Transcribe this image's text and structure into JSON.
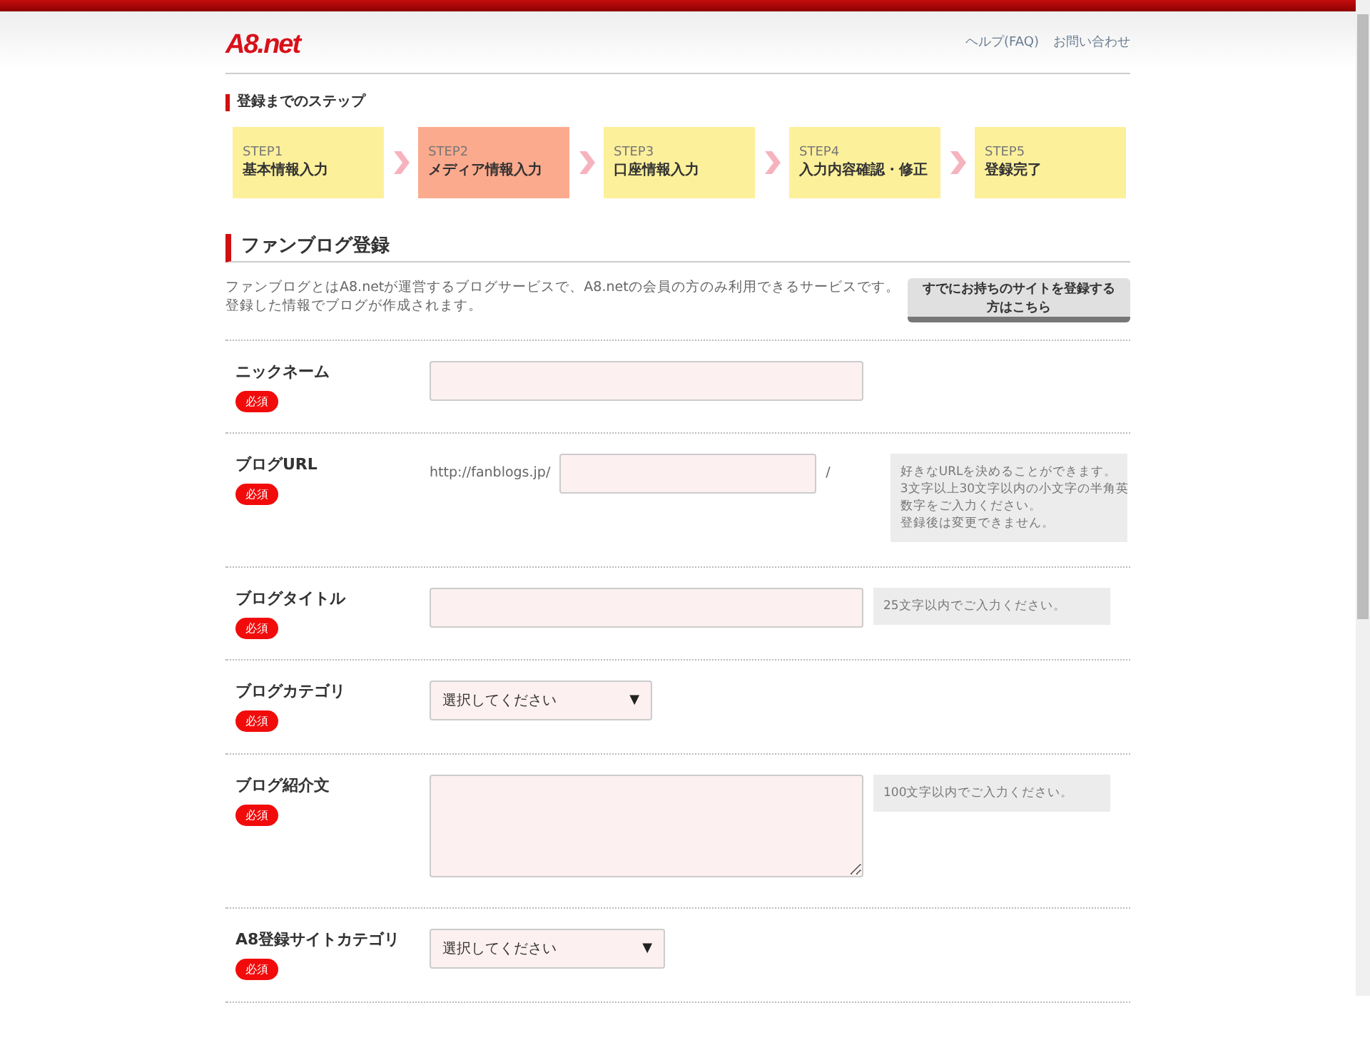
{
  "header": {
    "logo": "A8.net",
    "links": [
      "ヘルプ(FAQ)",
      "お問い合わせ"
    ]
  },
  "steps_section": {
    "title": "登録までのステップ",
    "steps": [
      {
        "number": "STEP1",
        "label": "基本情報入力",
        "selected": false
      },
      {
        "number": "STEP2",
        "label": "メディア情報入力",
        "selected": true
      },
      {
        "number": "STEP3",
        "label": "口座情報入力",
        "selected": false
      },
      {
        "number": "STEP4",
        "label": "入力内容確認・修正",
        "selected": false
      },
      {
        "number": "STEP5",
        "label": "登録完了",
        "selected": false
      }
    ]
  },
  "form": {
    "title": "ファンブログ登録",
    "description": [
      "ファンブログとはA8.netが運営するブログサービスで、A8.netの会員の方のみ利用できるサービスです。",
      "登録した情報でブログが作成されます。"
    ],
    "existing_site_button": "すでにお持ちのサイトを登録する方はこちら",
    "fields": [
      {
        "label": "ニックネーム",
        "badge": "必須",
        "kind": "text"
      },
      {
        "label": "ブログURL",
        "badge": "必須",
        "kind": "url",
        "prefix": "http://fanblogs.jp/",
        "suffix": "/",
        "hint": [
          "好きなURLを決めることができます。",
          "3文字以上30文字以内の小文字の半角英",
          "数字をご入力ください。",
          "登録後は変更できません。"
        ]
      },
      {
        "label": "ブログタイトル",
        "badge": "必須",
        "kind": "text",
        "hint": [
          "25文字以内でご入力ください。"
        ]
      },
      {
        "label": "ブログカテゴリ",
        "badge": "必須",
        "kind": "select",
        "value": "選択してください",
        "caret": "▼"
      },
      {
        "label": "ブログ紹介文",
        "badge": "必須",
        "kind": "textarea",
        "hint": [
          "100文字以内でご入力ください。"
        ]
      },
      {
        "label": "A8登録サイトカテゴリ",
        "badge": "必須",
        "kind": "select",
        "value": "選択してください",
        "caret": "▼"
      }
    ]
  }
}
